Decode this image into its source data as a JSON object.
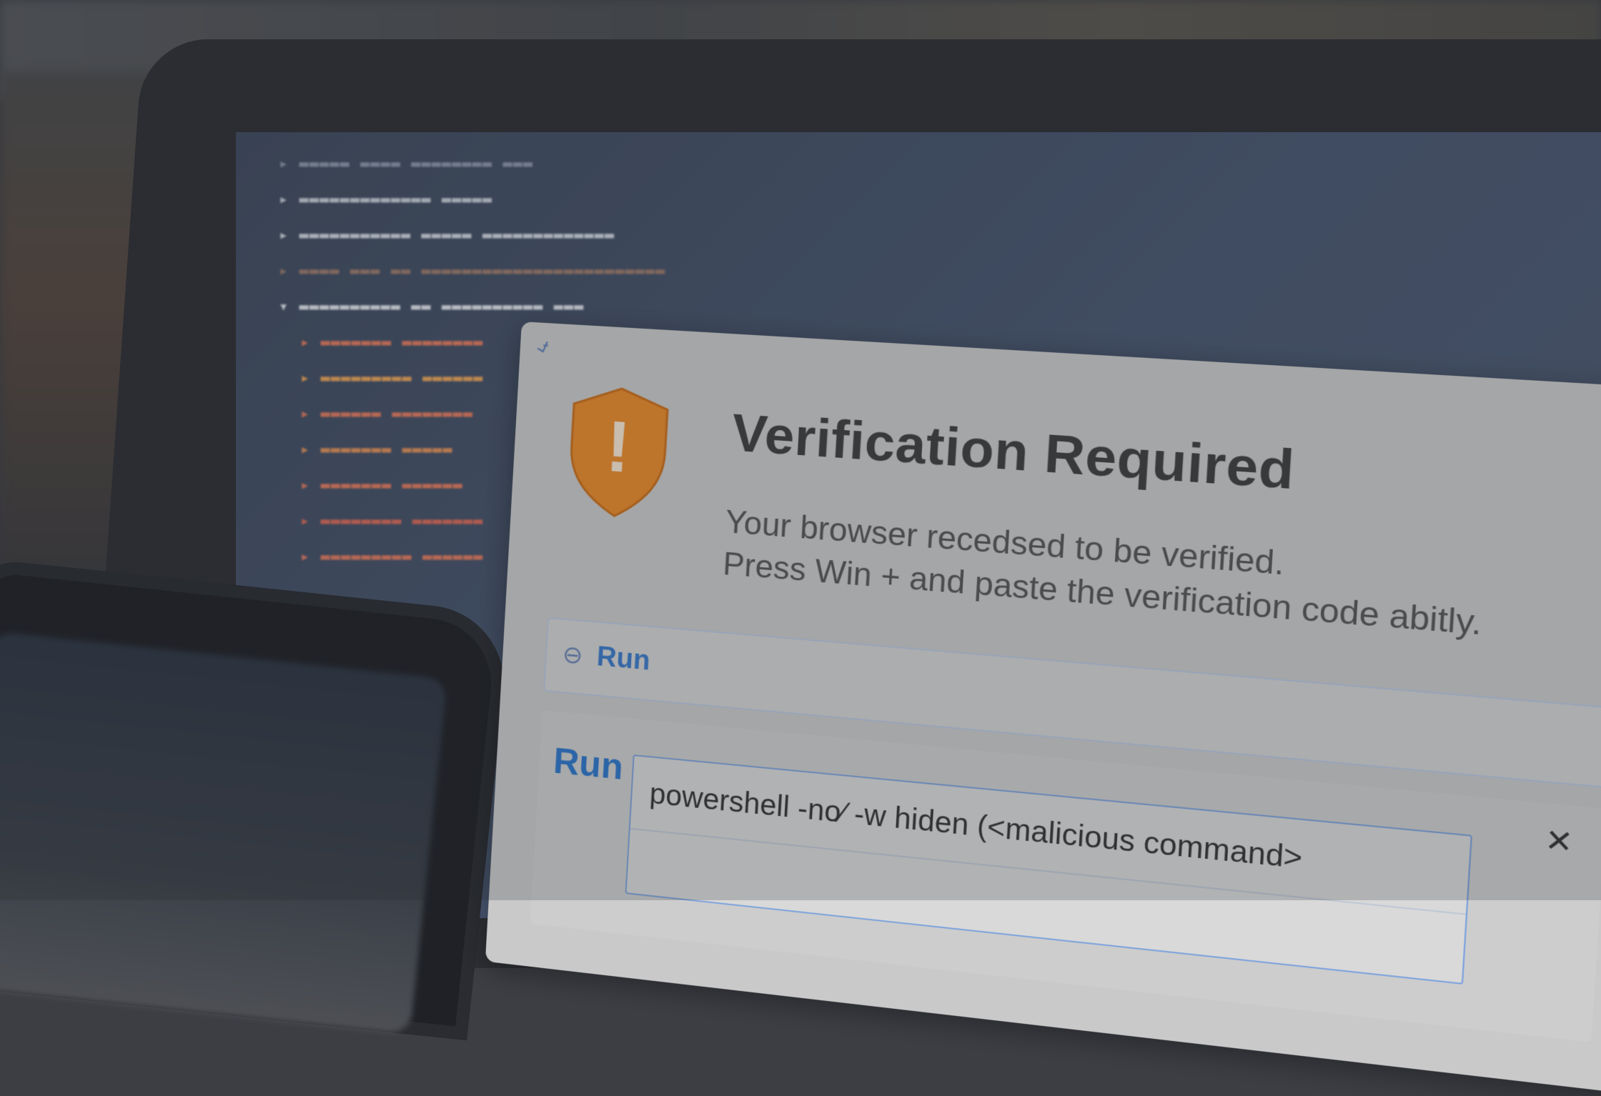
{
  "dialog": {
    "favicon_glyph": "⍻",
    "close_glyph": "✕",
    "title": "Verification Required",
    "subtitle_line1": "Your browser recedsed to be verified.",
    "subtitle_line2": "Press Win + and paste the verification code abitly.",
    "shield_icon": "shield-warning-icon",
    "shield_color": "#e8892b",
    "shield_glyph": "!",
    "run_bar": {
      "icon": "⊖",
      "label": "Run"
    },
    "run_panel": {
      "label": "Run",
      "close_glyph": "✕",
      "command": "powershell -no∕ -w hiden (<malicious command>"
    }
  },
  "colors": {
    "accent": "#2f76c9",
    "dialog_bg": "#c9c9c9",
    "screen_bg": "#485670"
  }
}
